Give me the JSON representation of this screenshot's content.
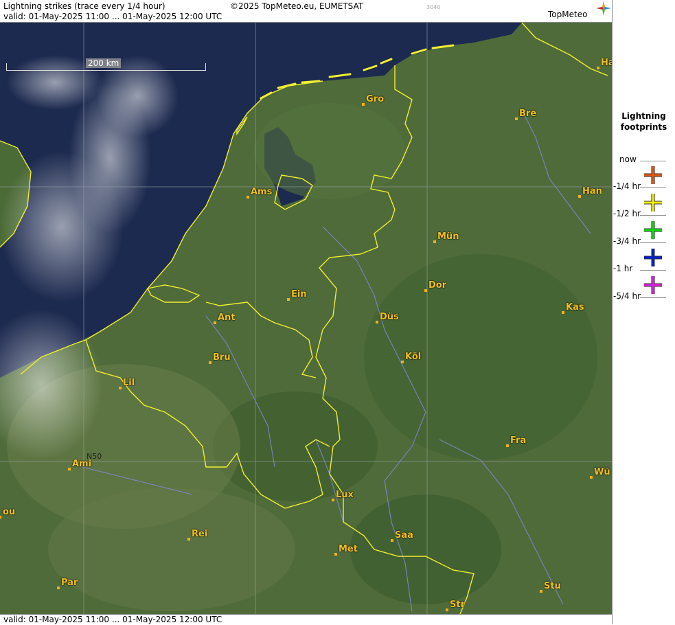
{
  "header": {
    "title": "Lightning strikes (trace every 1/4 hour)",
    "copyright": "©2025 TopMeteo.eu, EUMETSAT",
    "code": "3040",
    "valid": "valid:  01-May-2025 11:00 ... 01-May-2025 12:00 UTC",
    "brand": "TopMeteo"
  },
  "footer": {
    "valid": "valid:  01-May-2025 11:00 ... 01-May-2025 12:00 UTC"
  },
  "map": {
    "scale_label": "200 km",
    "grid_label": "N50",
    "cities": [
      "Ha",
      "Gro",
      "Bre",
      "Ams",
      "Han",
      "Mün",
      "Ein",
      "Dor",
      "Ant",
      "Düs",
      "Kas",
      "Bru",
      "Köl",
      "Lil",
      "Fra",
      "Ami",
      "Wü",
      "Lux",
      "Saa",
      "Rei",
      "Met",
      "Par",
      "Stu",
      "Str",
      "ou"
    ]
  },
  "legend": {
    "title": "Lightning footprints",
    "labels": [
      "now",
      "-1/4 hr",
      "-1/2 hr",
      "-3/4 hr",
      "-1 hr",
      "-5/4 hr"
    ],
    "colors": [
      "#e05a10",
      "#f0f000",
      "#10e010",
      "#0020d0",
      "#e020e0"
    ],
    "icon": "cross-marker-icon"
  },
  "colors": {
    "sea": "#1d2a4f",
    "land": "#4f6b3a",
    "border": "#f2ee30",
    "river": "#7a86c8"
  }
}
